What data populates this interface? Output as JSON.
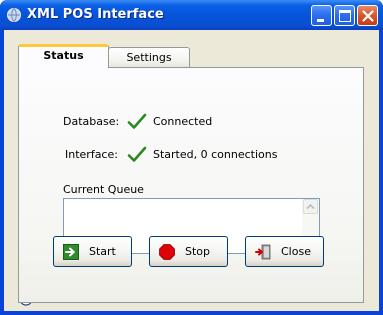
{
  "window": {
    "title": "XML POS Interface",
    "icons": {
      "app": "globe-icon",
      "minimize": "minimize-icon",
      "maximize": "maximize-icon",
      "close": "close-icon"
    },
    "colors": {
      "titlebar": "#0553d9",
      "close_button": "#d8562c",
      "client_bg": "#ece9d8"
    }
  },
  "tabs": [
    {
      "label": "Status",
      "active": true
    },
    {
      "label": "Settings",
      "active": false
    }
  ],
  "status": {
    "database": {
      "label": "Database:",
      "value": "Connected",
      "icon": "checkmark-icon"
    },
    "interface": {
      "label": "Interface:",
      "value": "Started, 0 connections",
      "icon": "checkmark-icon"
    },
    "check_color": "#2a8a1f"
  },
  "queue": {
    "label": "Current Queue",
    "content": ""
  },
  "buttons": {
    "start": {
      "label": "Start",
      "icon": "green-arrow-icon"
    },
    "stop": {
      "label": "Stop",
      "icon": "stop-sign-icon"
    },
    "close": {
      "label": "Close",
      "icon": "exit-door-icon"
    }
  },
  "statusbar": {
    "icon": "info-icon"
  }
}
